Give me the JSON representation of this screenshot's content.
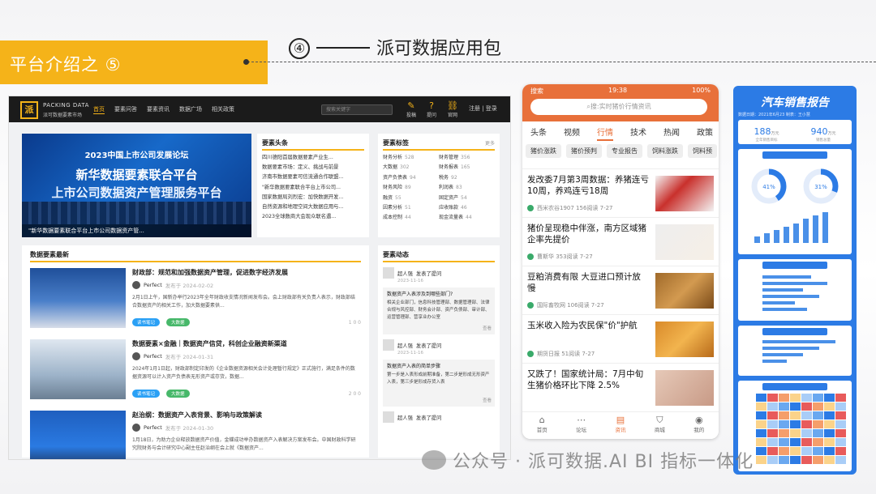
{
  "slide": {
    "section_title": "平台介绍之 ⑤",
    "sub_number": "④",
    "sub_title": "派可数据应用包"
  },
  "site": {
    "logo_mark": "派",
    "logo_en": "PACKING DATA",
    "logo_cn": "派可数据要素市场",
    "nav": [
      "首页",
      "要素问答",
      "要素资讯",
      "数据广场",
      "相关政策"
    ],
    "search_placeholder": "搜索关键字",
    "nav_icons": [
      {
        "icon": "edit-icon",
        "label": "投稿"
      },
      {
        "icon": "question-icon",
        "label": "提问"
      },
      {
        "icon": "link-icon",
        "label": "官网"
      }
    ],
    "login": "注册 | 登录",
    "banner": {
      "line1": "2023中国上市公司发展论坛",
      "line2": "新华数据要素联合平台",
      "line3": "上市公司数据资产管理服务平台",
      "caption": "\"新华数据要素联合平台上市公司数据资产管..."
    },
    "headlines": {
      "title": "要素头条",
      "items": [
        "四川德阳首届数据要素产业生...",
        "数据要素市场：定义、挑战与前景",
        "济南市数据要素可信流通合作联盟...",
        "\"新华数据要素联合平台上市公司...",
        "国家数据局刘烈宏：加快数据开发...",
        "自然资源和地理空间大数据应用与...",
        "2023全球数商大会现众联名遇..."
      ]
    },
    "tags": {
      "title": "要素标签",
      "more": "更多",
      "items": [
        {
          "name": "财务分析",
          "count": "528"
        },
        {
          "name": "财务管理",
          "count": "356"
        },
        {
          "name": "大数据",
          "count": "302"
        },
        {
          "name": "财务报表",
          "count": "165"
        },
        {
          "name": "资产负债表",
          "count": "94"
        },
        {
          "name": "税务",
          "count": "92"
        },
        {
          "name": "财务风险",
          "count": "89"
        },
        {
          "name": "利润表",
          "count": "83"
        },
        {
          "name": "融资",
          "count": "55"
        },
        {
          "name": "固定资产",
          "count": "54"
        },
        {
          "name": "因素分析",
          "count": "51"
        },
        {
          "name": "应收账款",
          "count": "46"
        },
        {
          "name": "成本控制",
          "count": "44"
        },
        {
          "name": "现金流量表",
          "count": "44"
        }
      ]
    },
    "news": {
      "title": "数据要素最新",
      "items": [
        {
          "title": "财政部：规范和加强数据资产管理，促进数字经济发展",
          "author": "Perfect",
          "date": "发布于 2024-02-02",
          "summary": "2月1日上午，国新办举行2023年全年财政收支情况新闻发布会。会上财政部有关负责人表示，财政部结合数据资产的相关工作，加大数据要素供...",
          "tag1": "读书笔记",
          "tag2": "大数据",
          "stats": "1  0  0"
        },
        {
          "title": "数据要素×金融｜数据资产信贷，科创企业融资新渠道",
          "author": "Perfect",
          "date": "发布于 2024-01-31",
          "summary": "2024年1月1日起，财政部制定印发的《企业数据资源相关会计处理暂行规定》正式施行，满足条件的数据资源可以计入资产负债表无形资产或存货，数据...",
          "tag1": "读书笔记",
          "tag2": "大数据",
          "stats": "2  0  0"
        },
        {
          "title": "赵治纲：数据资产入表背景、影响与政策解读",
          "author": "Perfect",
          "date": "发布于 2024-01-30",
          "summary": "1月18日，为助力企业释放数据资产价值，金蝶成功举办数据资产入表解决方案发布会。中国财政科学研究院财务与会计研究中心副主任赵治纲在会上就《数据资产...",
          "tag1": "读书笔记",
          "tag2": "大数据",
          "stats": ""
        }
      ]
    },
    "dynamics": {
      "title": "要素动态",
      "items": [
        {
          "user": "超人强",
          "action": "发表了提问",
          "date": "2023-11-16",
          "q": "数据资产入表涉及到哪些部门?",
          "body": "相关企业部门，信息科技管理部、数据管理部、法律合规与风控部、财务会计部、资产负债部、审计部、运营管理部、营享业办公室",
          "more": "查看"
        },
        {
          "user": "超人强",
          "action": "发表了提问",
          "date": "2023-11-16",
          "q": "数据资产入表的简单步骤",
          "body": "第一步是入表形成前期准备，第二步是形成无形资产入表，第三步是形成存货入表",
          "more": "查看"
        },
        {
          "user": "超人强",
          "action": "发表了提问",
          "date": "",
          "q": "",
          "body": "",
          "more": ""
        }
      ]
    }
  },
  "phone": {
    "status_left": "搜索",
    "time": "19:38",
    "battery": "100%",
    "search_placeholder": "搜:实时猪价行情资讯",
    "tabs": [
      "头条",
      "视频",
      "行情",
      "技术",
      "热闻",
      "政策"
    ],
    "chips": [
      "猪价涨跌",
      "猪价预判",
      "专业报告",
      "饲料涨跌",
      "饲料预"
    ],
    "items": [
      {
        "title": "发改委7月第3周数据：养猪连亏10周，养鸡连亏18周",
        "meta": "西米农谷1907  156阅读  7-27"
      },
      {
        "title": "猪价呈现稳中伴涨，南方区域猪企率先提价",
        "meta": "曹斯华  353阅读  7-27"
      },
      {
        "title": "豆粕消费有限 大豆进口预计放慢",
        "meta": "国际畜牧网  106阅读  7-27"
      },
      {
        "title": "玉米收入险为农民保\"价\"护航",
        "meta": "期货日报  51阅读  7-27"
      },
      {
        "title": "又跌了！国家统计局：7月中旬生猪价格环比下降 2.5%",
        "meta": ""
      }
    ],
    "bottom": [
      {
        "icon": "home-icon",
        "label": "首页"
      },
      {
        "icon": "forum-icon",
        "label": "论坛"
      },
      {
        "icon": "news-icon",
        "label": "资讯"
      },
      {
        "icon": "shop-icon",
        "label": "商城"
      },
      {
        "icon": "user-icon",
        "label": "我的"
      }
    ]
  },
  "report": {
    "title": "汽车销售报告",
    "subtitle": "数据日期：2021年6月23    制表：王小慧",
    "stat1_value": "188",
    "stat1_unit": "万元",
    "stat1_label": "全年销售目标",
    "stat2_value": "940",
    "stat2_unit": "万元",
    "stat2_label": "销售总量",
    "gauge1": "41%",
    "gauge2": "31%"
  },
  "watermark": "公众号 · 派可数据.AI BI 指标一体化",
  "colors": {
    "accent": "#f5b319",
    "phone_accent": "#e8703a",
    "report_blue": "#2c7be5"
  }
}
